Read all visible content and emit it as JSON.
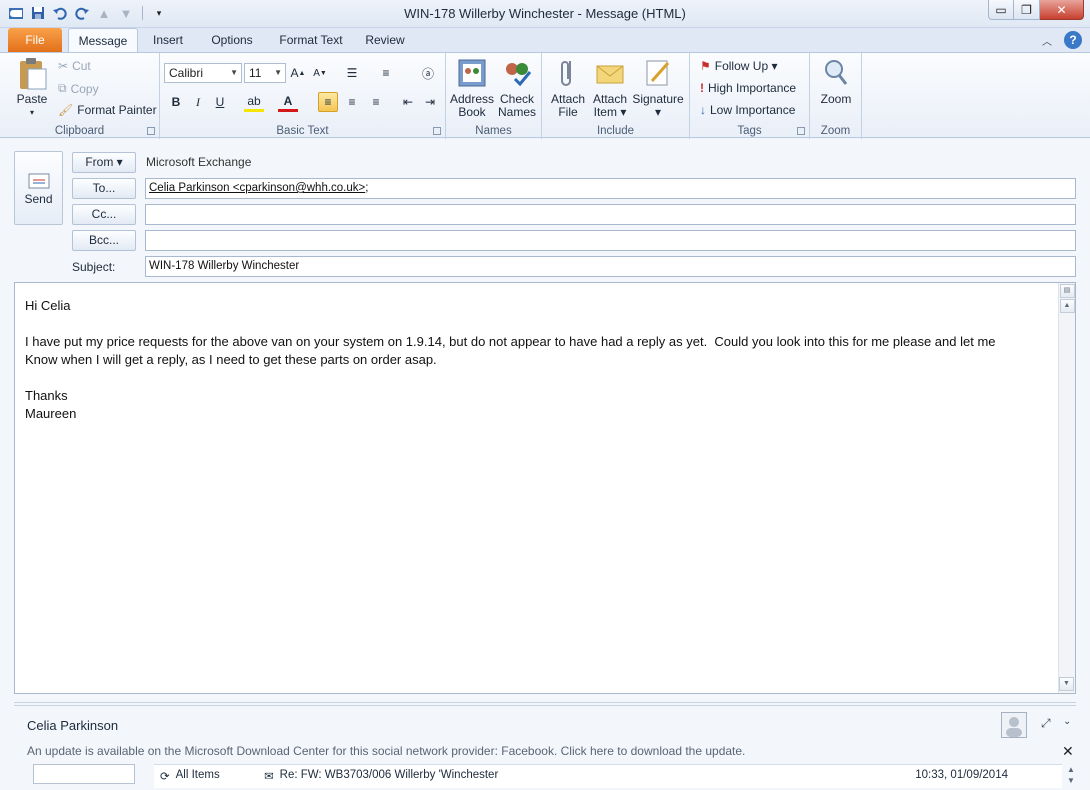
{
  "window": {
    "title": "WIN-178   Willerby Winchester  -  Message (HTML)",
    "min": "▭",
    "max": "❐",
    "close": "✕"
  },
  "tabs": {
    "file": "File",
    "message": "Message",
    "insert": "Insert",
    "options": "Options",
    "format_text": "Format Text",
    "review": "Review"
  },
  "ribbon": {
    "clipboard": {
      "label": "Clipboard",
      "paste": "Paste",
      "cut": "Cut",
      "copy": "Copy",
      "format_painter": "Format Painter"
    },
    "basic_text": {
      "label": "Basic Text",
      "font": "Calibri",
      "size": "11",
      "bold": "B",
      "italic": "I",
      "underline": "U"
    },
    "names": {
      "label": "Names",
      "address_book": "Address\nBook",
      "check_names": "Check\nNames"
    },
    "include": {
      "label": "Include",
      "attach_file": "Attach\nFile",
      "attach_item": "Attach\nItem ▾",
      "signature": "Signature\n▾"
    },
    "tags": {
      "label": "Tags",
      "follow_up": "Follow Up ▾",
      "high_importance": "High Importance",
      "low_importance": "Low Importance"
    },
    "zoom": {
      "label": "Zoom",
      "zoom": "Zoom"
    }
  },
  "header": {
    "send": "Send",
    "from_btn": "From ▾",
    "from_value": "Microsoft Exchange",
    "to_btn": "To...",
    "to_value": "Celia Parkinson <cparkinson@whh.co.uk>",
    "to_suffix": ";",
    "cc_btn": "Cc...",
    "cc_value": "",
    "bcc_btn": "Bcc...",
    "bcc_value": "",
    "subject_label": "Subject:",
    "subject_value": "WIN-178   Willerby Winchester"
  },
  "body": {
    "greeting": "Hi Celia",
    "para1_line1": "I have put my price requests for the above van on your system on 1.9.14, but do not appear to have had a reply as yet.  Could you look into this for me please and let me",
    "para1_line2": "Know when I will get a reply, as I need to get these parts on order asap.",
    "thanks": "Thanks",
    "signature": "Maureen"
  },
  "people_pane": {
    "name": "Celia Parkinson",
    "notice": "An update is available on the Microsoft Download Center for this social network provider: Facebook. Click here to download the update.",
    "all_items": "All Items",
    "message_subject": "Re: FW: WB3703/006 Willerby 'Winchester",
    "message_date": "10:33, 01/09/2014"
  },
  "colors": {
    "file_tab": "#e3701a",
    "accent": "#3a78c8"
  }
}
